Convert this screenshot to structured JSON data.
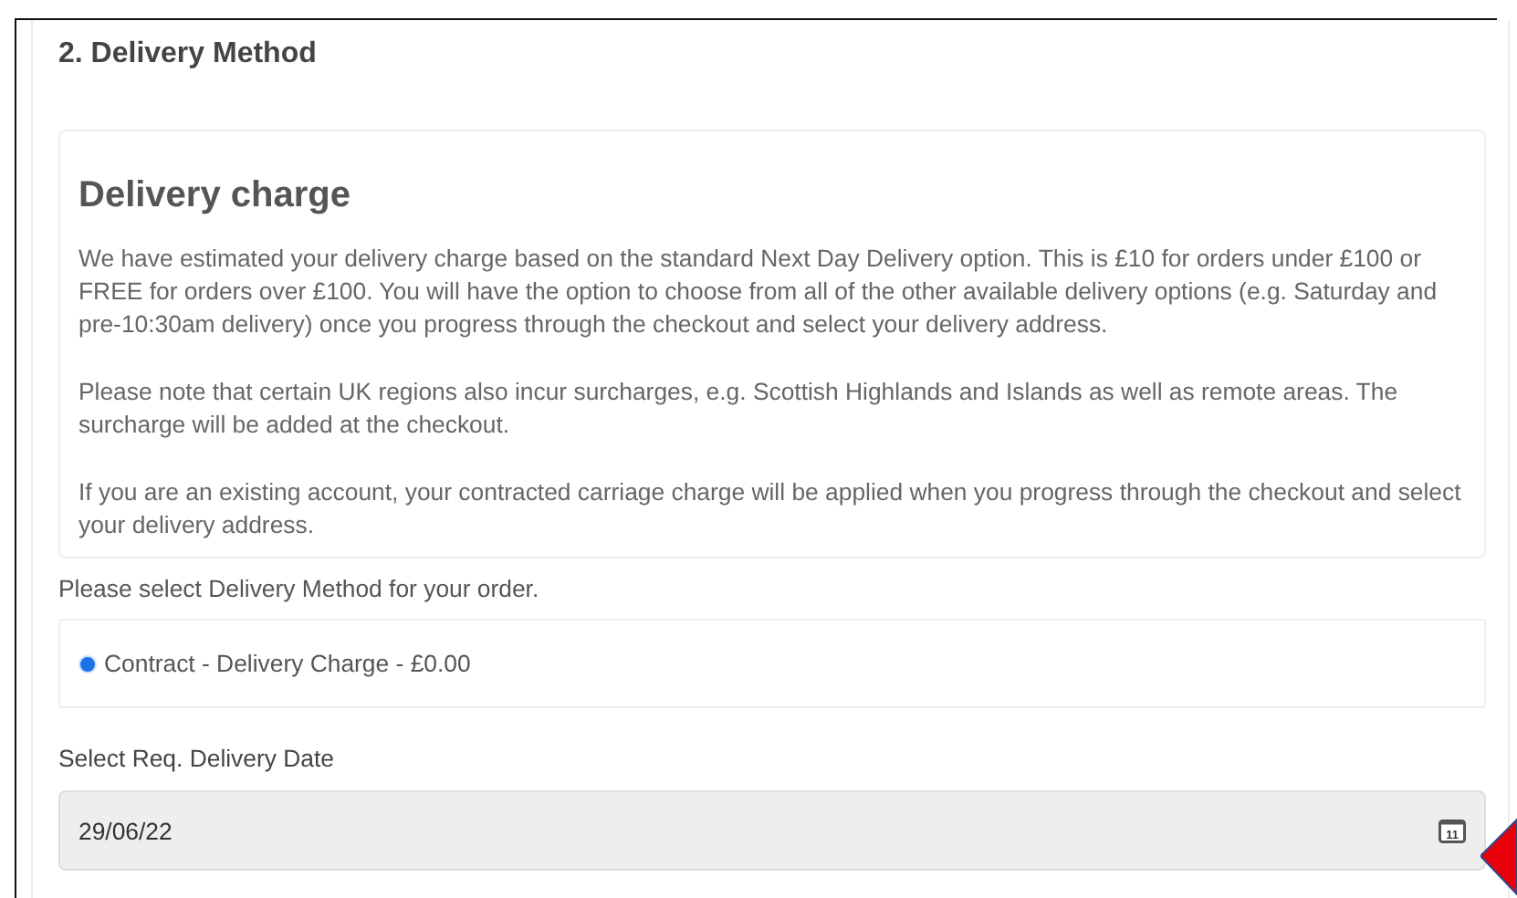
{
  "section_title": "2. Delivery Method",
  "info_card": {
    "title": "Delivery charge",
    "paragraphs": [
      "We have estimated your delivery charge based on the standard Next Day Delivery option. This is £10 for orders under £100 or FREE for orders over £100. You will have the option to choose from all of the other available delivery options (e.g. Saturday and pre-10:30am delivery) once you progress through the checkout and select your delivery address.",
      "Please note that certain UK regions also incur surcharges, e.g. Scottish Highlands and Islands as well as remote areas. The surcharge will be added at the checkout.",
      "If you are an existing account, your contracted carriage charge will be applied when you progress through the checkout and select your delivery address."
    ]
  },
  "method_prompt": "Please select Delivery Method for your order.",
  "methods": [
    {
      "label": "Contract - Delivery Charge - £0.00",
      "selected": true
    }
  ],
  "date_label": "Select Req. Delivery Date",
  "date_field": {
    "value": "29/06/22",
    "calendar_day": "11"
  }
}
